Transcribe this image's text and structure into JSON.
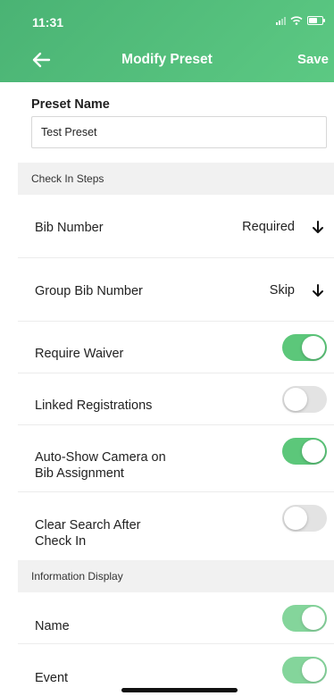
{
  "status_bar": {
    "time": "11:31"
  },
  "header": {
    "title": "Modify Preset",
    "save_label": "Save"
  },
  "preset_name": {
    "label": "Preset Name",
    "value": "Test Preset"
  },
  "check_in_steps": {
    "header": "Check In Steps",
    "bib_number": {
      "label": "Bib Number",
      "value": "Required"
    },
    "group_bib_number": {
      "label": "Group Bib Number",
      "value": "Skip"
    },
    "require_waiver": {
      "label": "Require Waiver",
      "enabled": true
    },
    "linked_registrations": {
      "label": "Linked Registrations",
      "enabled": false
    },
    "auto_show_camera": {
      "label_line1": "Auto-Show Camera on",
      "label_line2": "Bib Assignment",
      "enabled": true
    },
    "clear_search": {
      "label_line1": "Clear Search After",
      "label_line2": "Check In",
      "enabled": false
    }
  },
  "information_display": {
    "header": "Information Display",
    "name": {
      "label": "Name",
      "enabled": true
    },
    "event": {
      "label": "Event",
      "enabled": true
    }
  },
  "colors": {
    "accent": "#4ab374",
    "toggle_on": "#5cc77a",
    "toggle_off": "#e3e3e3"
  }
}
